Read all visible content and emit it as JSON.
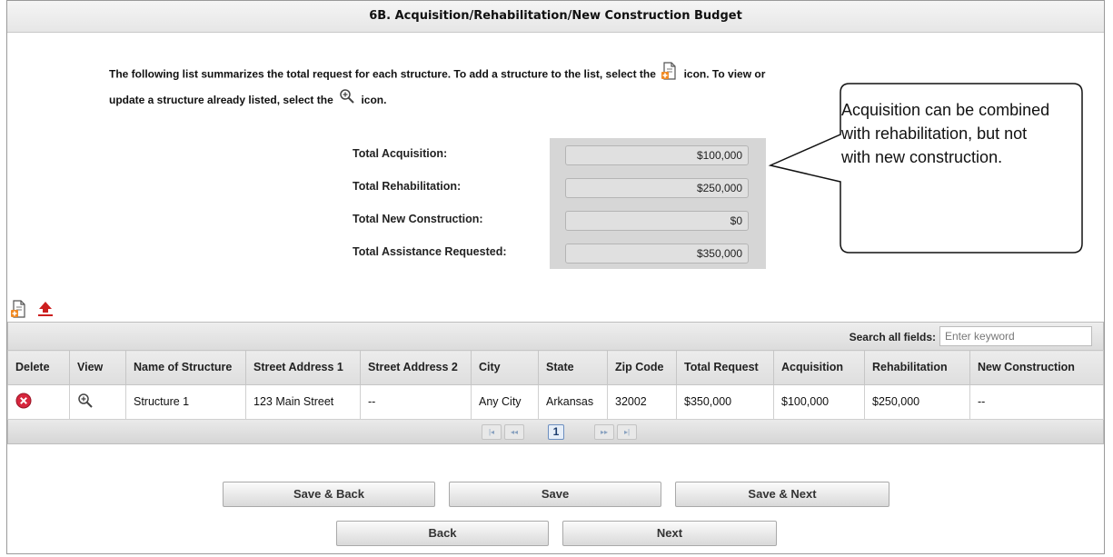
{
  "title": "6B. Acquisition/Rehabilitation/New Construction Budget",
  "intro": {
    "part1": "The following list summarizes the total request for each structure. To add a structure to the list, select the",
    "part2": "icon. To view or update a structure already listed, select the",
    "part3": "icon."
  },
  "totals": [
    {
      "label": "Total Acquisition:",
      "value": "$100,000"
    },
    {
      "label": "Total Rehabilitation:",
      "value": "$250,000"
    },
    {
      "label": "Total New Construction:",
      "value": "$0"
    },
    {
      "label": "Total Assistance Requested:",
      "value": "$350,000"
    }
  ],
  "callout": "Acquisition can be combined with rehabilitation, but not with new construction.",
  "toolbar": {
    "add_icon": "add-document-icon",
    "export_icon": "export-icon"
  },
  "search": {
    "label": "Search all fields:",
    "placeholder": "Enter keyword"
  },
  "table": {
    "headers": [
      "Delete",
      "View",
      "Name of Structure",
      "Street Address 1",
      "Street Address 2",
      "City",
      "State",
      "Zip Code",
      "Total Request",
      "Acquisition",
      "Rehabilitation",
      "New Construction"
    ],
    "rows": [
      {
        "name": "Structure 1",
        "street1": "123 Main Street",
        "street2": "--",
        "city": "Any City",
        "state": "Arkansas",
        "zip": "32002",
        "total": "$350,000",
        "acquisition": "$100,000",
        "rehabilitation": "$250,000",
        "new_construction": "--"
      }
    ]
  },
  "pager": {
    "first": "|◂",
    "prev": "◂◂",
    "current": "1",
    "next": "▸▸",
    "last": "▸|"
  },
  "buttons": {
    "save_back": "Save & Back",
    "save": "Save",
    "save_next": "Save & Next",
    "back": "Back",
    "next": "Next"
  },
  "colors": {
    "delete_red": "#d7263d",
    "panel_gray": "#d6d6d6",
    "export_red": "#cc1f1f"
  }
}
